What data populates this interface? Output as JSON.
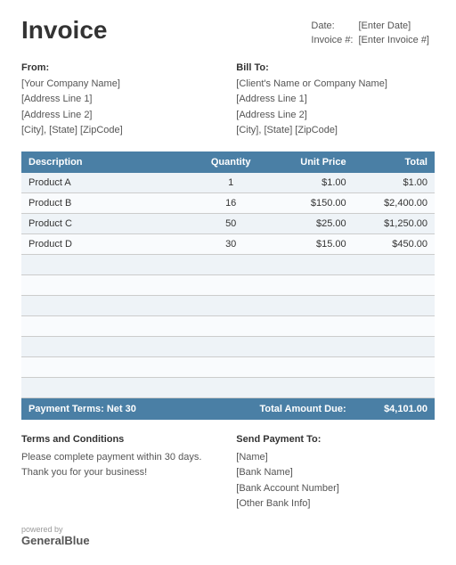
{
  "header": {
    "title": "Invoice",
    "date_label": "Date:",
    "date_value": "[Enter Date]",
    "invoice_label": "Invoice #:",
    "invoice_value": "[Enter Invoice #]"
  },
  "from": {
    "label": "From:",
    "company": "[Your Company Name]",
    "address1": "[Address Line 1]",
    "address2": "[Address Line 2]",
    "city": "[City], [State] [ZipCode]"
  },
  "bill_to": {
    "label": "Bill To:",
    "company": "[Client's Name or Company Name]",
    "address1": "[Address Line 1]",
    "address2": "[Address Line 2]",
    "city": "[City], [State] [ZipCode]"
  },
  "table": {
    "headers": {
      "description": "Description",
      "quantity": "Quantity",
      "unit_price": "Unit Price",
      "total": "Total"
    },
    "rows": [
      {
        "description": "Product A",
        "quantity": "1",
        "unit_price": "$1.00",
        "total": "$1.00"
      },
      {
        "description": "Product B",
        "quantity": "16",
        "unit_price": "$150.00",
        "total": "$2,400.00"
      },
      {
        "description": "Product C",
        "quantity": "50",
        "unit_price": "$25.00",
        "total": "$1,250.00"
      },
      {
        "description": "Product D",
        "quantity": "30",
        "unit_price": "$15.00",
        "total": "$450.00"
      },
      {
        "description": "",
        "quantity": "",
        "unit_price": "",
        "total": ""
      },
      {
        "description": "",
        "quantity": "",
        "unit_price": "",
        "total": ""
      },
      {
        "description": "",
        "quantity": "",
        "unit_price": "",
        "total": ""
      },
      {
        "description": "",
        "quantity": "",
        "unit_price": "",
        "total": ""
      },
      {
        "description": "",
        "quantity": "",
        "unit_price": "",
        "total": ""
      },
      {
        "description": "",
        "quantity": "",
        "unit_price": "",
        "total": ""
      },
      {
        "description": "",
        "quantity": "",
        "unit_price": "",
        "total": ""
      }
    ],
    "footer": {
      "payment_terms": "Payment Terms: Net 30",
      "total_label": "Total Amount Due:",
      "total_value": "$4,101.00"
    }
  },
  "terms": {
    "label": "Terms and Conditions",
    "line1": "Please complete payment within 30 days.",
    "line2": "Thank you for your business!"
  },
  "send_payment": {
    "label": "Send Payment To:",
    "name": "[Name]",
    "bank": "[Bank Name]",
    "account": "[Bank Account Number]",
    "other": "[Other Bank Info]"
  },
  "powered": {
    "text": "powered by",
    "brand": "GeneralBlue"
  }
}
